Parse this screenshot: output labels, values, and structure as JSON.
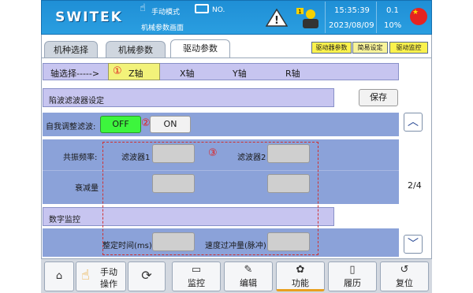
{
  "header": {
    "logo": "SWITEK",
    "mode": "手动模式",
    "file_label": "NO.",
    "screen_name": "机械参数画面",
    "time": "15:35:39",
    "date": "2023/08/09",
    "value_top": "0.1",
    "value_bottom": "10%"
  },
  "tabs": [
    {
      "label": "机种选择"
    },
    {
      "label": "机械参数"
    },
    {
      "label": "驱动参数"
    }
  ],
  "quick_buttons": [
    "驱动器参数",
    "简易设定",
    "驱动监控"
  ],
  "axis": {
    "label": "轴选择----->",
    "items": [
      "Z轴",
      "X轴",
      "Y轴",
      "R轴"
    ],
    "marker": "①"
  },
  "notch": {
    "section_title": "陷波滤波器设定",
    "save": "保存",
    "self_adjust_label": "自我调整滤波:",
    "off": "OFF",
    "on": "ON",
    "marker2": "②",
    "resonance_label": "共振频率:",
    "filter1": "滤波器1",
    "filter2": "滤波器2",
    "marker3": "③",
    "attenuation_label": "衰减量"
  },
  "monitor": {
    "section_title": "数字监控",
    "settle_time": "整定时间(ms)",
    "overshoot": "速度过冲量(脉冲)"
  },
  "page_indicator": "2/4",
  "footer": {
    "manual": "手动",
    "operate": "操作",
    "monitor": "监控",
    "edit": "编辑",
    "function": "功能",
    "history": "履历",
    "reset": "复位"
  },
  "colors": {
    "header": "#2196db",
    "off_active": "#3df53d",
    "axis_active": "#f2f27a",
    "marker": "#e02020"
  }
}
